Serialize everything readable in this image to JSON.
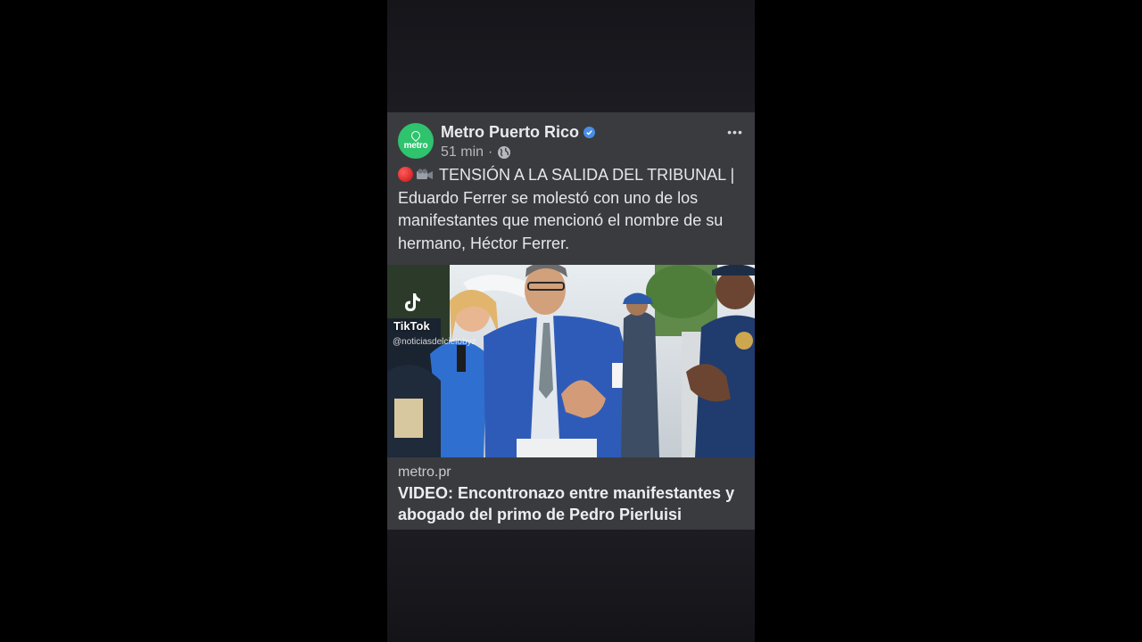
{
  "post": {
    "page_name": "Metro Puerto Rico",
    "avatar_text": "metro",
    "time": "51 min",
    "separator": "·",
    "caption": "TENSIÓN A LA SALIDA DEL TRIBUNAL | Eduardo Ferrer se molestó con uno de los manifestantes que mencionó el nombre de su hermano, Héctor Ferrer.",
    "more_label": "•••"
  },
  "media": {
    "watermark": "TikTok",
    "handle": "@noticiasdelcielobyz"
  },
  "link": {
    "domain": "metro.pr",
    "title": "VIDEO: Encontronazo entre manifestantes y abogado del primo de Pedro Pierluisi"
  },
  "colors": {
    "brand_green": "#2fc36e",
    "verified_blue": "#4a8de6",
    "card_bg": "#3a3b3f"
  }
}
